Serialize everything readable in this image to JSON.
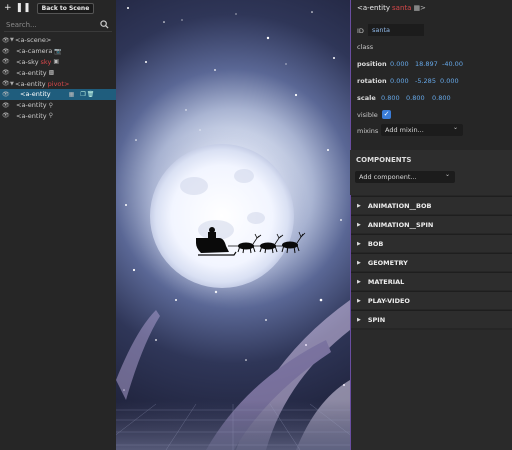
{
  "toolbar": {
    "back_label": "Back to Scene",
    "search_placeholder": "Search..."
  },
  "tree": [
    {
      "label": "<a-scene>",
      "extra": "",
      "icon": ""
    },
    {
      "label": "<a-camera",
      "extra": "",
      "icon": "camera-icon"
    },
    {
      "label": "<a-sky",
      "extra": "sky",
      "icon": "image-icon"
    },
    {
      "label": "<a-entity",
      "extra": "",
      "icon": "code-icon"
    },
    {
      "label": "<a-entity",
      "extra": "pivot>",
      "icon": ""
    },
    {
      "label": "<a-entity",
      "extra": "",
      "icon": "cube-icon",
      "selected": true
    },
    {
      "label": "<a-entity",
      "extra": "",
      "icon": "bulb-icon"
    },
    {
      "label": "<a-entity",
      "extra": "",
      "icon": "bulb-icon"
    }
  ],
  "inspector": {
    "title_tag": "<a-entity",
    "title_name": "santa",
    "id_label": "ID",
    "id_value": "santa",
    "class_label": "class",
    "position_label": "position",
    "position": [
      "0.000",
      "18.897",
      "-40.00"
    ],
    "rotation_label": "rotation",
    "rotation": [
      "0.000",
      "-5.285",
      "0.000"
    ],
    "scale_label": "scale",
    "scale": [
      "0.800",
      "0.800",
      "0.800"
    ],
    "visible_label": "visible",
    "mixins_label": "mixins",
    "mixins_placeholder": "Add mixin...",
    "components_title": "COMPONENTS",
    "add_component": "Add component...",
    "components": [
      "ANIMATION__BOB",
      "ANIMATION__SPIN",
      "BOB",
      "GEOMETRY",
      "MATERIAL",
      "PLAY-VIDEO",
      "SPIN"
    ]
  },
  "colors": {
    "accent": "#1f5d7d",
    "entity_name": "#d6474a",
    "number": "#66a8e8",
    "checkbox": "#3a7dd9"
  }
}
